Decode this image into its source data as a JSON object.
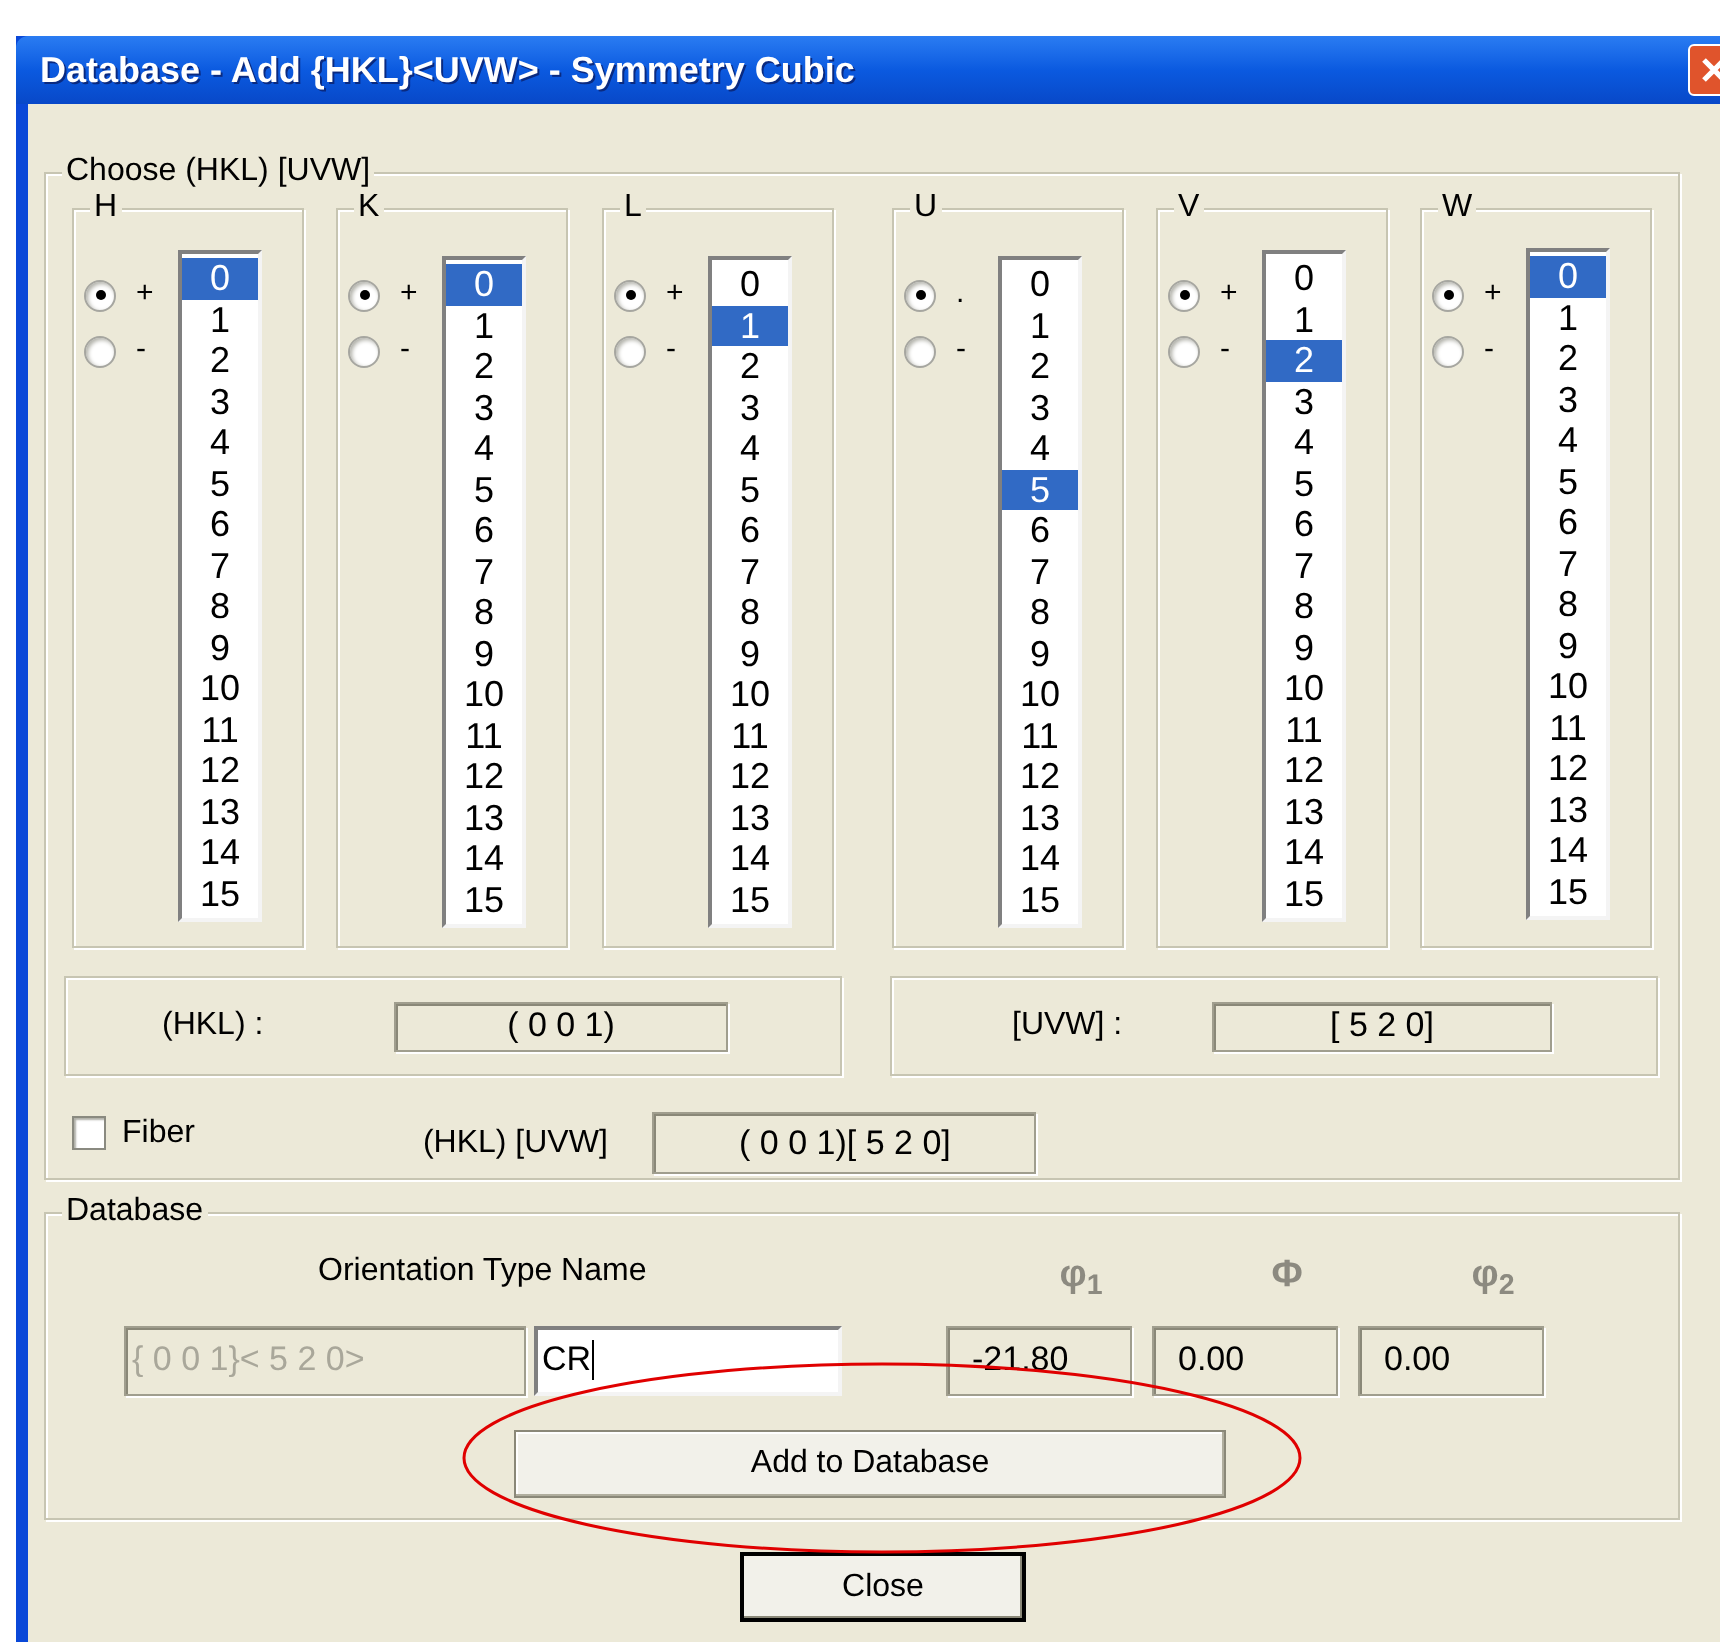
{
  "window": {
    "title": "Database - Add {HKL}<UVW> - Symmetry Cubic"
  },
  "choose_group": {
    "label": "Choose (HKL)  [UVW]"
  },
  "columns": [
    {
      "label": "H",
      "signs": [
        {
          "label": "+",
          "selected": true
        },
        {
          "label": "-",
          "selected": false
        }
      ],
      "items": [
        {
          "text": "0",
          "selected": true
        },
        {
          "text": "1",
          "selected": false
        },
        {
          "text": "2",
          "selected": false
        },
        {
          "text": "3",
          "selected": false
        },
        {
          "text": "4",
          "selected": false
        },
        {
          "text": "5",
          "selected": false
        },
        {
          "text": "6",
          "selected": false
        },
        {
          "text": "7",
          "selected": false
        },
        {
          "text": "8",
          "selected": false
        },
        {
          "text": "9",
          "selected": false
        },
        {
          "text": "10",
          "selected": false
        },
        {
          "text": "11",
          "selected": false
        },
        {
          "text": "12",
          "selected": false
        },
        {
          "text": "13",
          "selected": false
        },
        {
          "text": "14",
          "selected": false
        },
        {
          "text": "15",
          "selected": false
        }
      ]
    },
    {
      "label": "K",
      "signs": [
        {
          "label": "+",
          "selected": true
        },
        {
          "label": "-",
          "selected": false
        }
      ],
      "items": [
        {
          "text": "0",
          "selected": true
        },
        {
          "text": "1",
          "selected": false
        },
        {
          "text": "2",
          "selected": false
        },
        {
          "text": "3",
          "selected": false
        },
        {
          "text": "4",
          "selected": false
        },
        {
          "text": "5",
          "selected": false
        },
        {
          "text": "6",
          "selected": false
        },
        {
          "text": "7",
          "selected": false
        },
        {
          "text": "8",
          "selected": false
        },
        {
          "text": "9",
          "selected": false
        },
        {
          "text": "10",
          "selected": false
        },
        {
          "text": "11",
          "selected": false
        },
        {
          "text": "12",
          "selected": false
        },
        {
          "text": "13",
          "selected": false
        },
        {
          "text": "14",
          "selected": false
        },
        {
          "text": "15",
          "selected": false
        }
      ]
    },
    {
      "label": "L",
      "signs": [
        {
          "label": "+",
          "selected": true
        },
        {
          "label": "-",
          "selected": false
        }
      ],
      "items": [
        {
          "text": "0",
          "selected": false
        },
        {
          "text": "1",
          "selected": true
        },
        {
          "text": "2",
          "selected": false
        },
        {
          "text": "3",
          "selected": false
        },
        {
          "text": "4",
          "selected": false
        },
        {
          "text": "5",
          "selected": false
        },
        {
          "text": "6",
          "selected": false
        },
        {
          "text": "7",
          "selected": false
        },
        {
          "text": "8",
          "selected": false
        },
        {
          "text": "9",
          "selected": false
        },
        {
          "text": "10",
          "selected": false
        },
        {
          "text": "11",
          "selected": false
        },
        {
          "text": "12",
          "selected": false
        },
        {
          "text": "13",
          "selected": false
        },
        {
          "text": "14",
          "selected": false
        },
        {
          "text": "15",
          "selected": false
        }
      ]
    },
    {
      "label": "U",
      "signs": [
        {
          "label": ".",
          "selected": true
        },
        {
          "label": "-",
          "selected": false
        }
      ],
      "items": [
        {
          "text": "0",
          "selected": false
        },
        {
          "text": "1",
          "selected": false
        },
        {
          "text": "2",
          "selected": false
        },
        {
          "text": "3",
          "selected": false
        },
        {
          "text": "4",
          "selected": false
        },
        {
          "text": "5",
          "selected": true
        },
        {
          "text": "6",
          "selected": false
        },
        {
          "text": "7",
          "selected": false
        },
        {
          "text": "8",
          "selected": false
        },
        {
          "text": "9",
          "selected": false
        },
        {
          "text": "10",
          "selected": false
        },
        {
          "text": "11",
          "selected": false
        },
        {
          "text": "12",
          "selected": false
        },
        {
          "text": "13",
          "selected": false
        },
        {
          "text": "14",
          "selected": false
        },
        {
          "text": "15",
          "selected": false
        }
      ]
    },
    {
      "label": "V",
      "signs": [
        {
          "label": "+",
          "selected": true
        },
        {
          "label": "-",
          "selected": false
        }
      ],
      "items": [
        {
          "text": "0",
          "selected": false
        },
        {
          "text": "1",
          "selected": false
        },
        {
          "text": "2",
          "selected": true
        },
        {
          "text": "3",
          "selected": false
        },
        {
          "text": "4",
          "selected": false
        },
        {
          "text": "5",
          "selected": false
        },
        {
          "text": "6",
          "selected": false
        },
        {
          "text": "7",
          "selected": false
        },
        {
          "text": "8",
          "selected": false
        },
        {
          "text": "9",
          "selected": false
        },
        {
          "text": "10",
          "selected": false
        },
        {
          "text": "11",
          "selected": false
        },
        {
          "text": "12",
          "selected": false
        },
        {
          "text": "13",
          "selected": false
        },
        {
          "text": "14",
          "selected": false
        },
        {
          "text": "15",
          "selected": false
        }
      ]
    },
    {
      "label": "W",
      "signs": [
        {
          "label": "+",
          "selected": true
        },
        {
          "label": "-",
          "selected": false
        }
      ],
      "items": [
        {
          "text": "0",
          "selected": true
        },
        {
          "text": "1",
          "selected": false
        },
        {
          "text": "2",
          "selected": false
        },
        {
          "text": "3",
          "selected": false
        },
        {
          "text": "4",
          "selected": false
        },
        {
          "text": "5",
          "selected": false
        },
        {
          "text": "6",
          "selected": false
        },
        {
          "text": "7",
          "selected": false
        },
        {
          "text": "8",
          "selected": false
        },
        {
          "text": "9",
          "selected": false
        },
        {
          "text": "10",
          "selected": false
        },
        {
          "text": "11",
          "selected": false
        },
        {
          "text": "12",
          "selected": false
        },
        {
          "text": "13",
          "selected": false
        },
        {
          "text": "14",
          "selected": false
        },
        {
          "text": "15",
          "selected": false
        }
      ]
    }
  ],
  "hkl_summary": {
    "label": "(HKL) :",
    "value": "( 0  0 1)"
  },
  "uvw_summary": {
    "label": "[UVW] :",
    "value": "[ 5  2  0]"
  },
  "fiber": {
    "label": "Fiber",
    "checked": false
  },
  "combined": {
    "label": "(HKL) [UVW]",
    "value": "( 0  0 1)[ 5  2  0]"
  },
  "database_group": {
    "label": "Database",
    "name_heading": "Orientation Type Name",
    "angle_headings": [
      "φ$_{1}$",
      "Φ",
      "φ$_{2}$"
    ],
    "family_value": "{ 0  0 1}< 5  2 0>",
    "name_value": "CR",
    "angles": [
      "-21.80",
      "0.00",
      "0.00"
    ],
    "add_button": "Add to Database"
  },
  "close_button": "Close"
}
